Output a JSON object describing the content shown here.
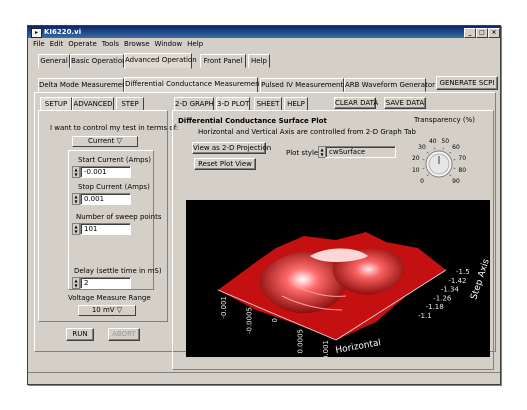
{
  "window": {
    "title": "KI6220.vi"
  },
  "menu": [
    "File",
    "Edit",
    "Operate",
    "Tools",
    "Browse",
    "Window",
    "Help"
  ],
  "tabs_top": [
    "General",
    "Basic Operation",
    "Advanced Operation",
    "Front Panel",
    "Help"
  ],
  "tabs_second": [
    "Delta Mode Measurements",
    "Differential Conductance Measurements",
    "Pulsed IV Measurements",
    "ARB Waveform Generator"
  ],
  "generate_scpi": "GENERATE SCPI",
  "left_tabs": [
    "SETUP",
    "ADVANCED",
    "STEP"
  ],
  "control": {
    "prompt": "I want to control my test in terms of:",
    "mode": "Current",
    "start_label": "Start Current (Amps)",
    "start_value": "-0.001",
    "stop_label": "Stop Current (Amps)",
    "stop_value": "0.001",
    "points_label": "Number of sweep points",
    "points_value": "101",
    "delay_label": "Delay (settle time in mS)",
    "delay_value": "2",
    "range_label": "Voltage Measure Range",
    "range_value": "10 mV"
  },
  "run_label": "RUN",
  "abort_label": "ABORT",
  "plot_tabs": [
    "2-D GRAPH",
    "3-D PLOT",
    "SHEET",
    "HELP"
  ],
  "clear_data": "CLEAR DATA",
  "save_data": "SAVE DATA",
  "plot": {
    "title": "Differential Conductance Surface Plot",
    "subtitle": "Horizontal and Vertical Axis are controlled from 2-D Graph Tab",
    "view_2d": "View as 2-D Projection",
    "reset_view": "Reset Plot View",
    "style_label": "Plot style",
    "style_value": "cwSurface",
    "transparency_label": "Transparency (%)",
    "dial_ticks": [
      "0",
      "10",
      "20",
      "30",
      "40",
      "50",
      "60",
      "70",
      "80",
      "90"
    ],
    "step_ticks": [
      "-1.5",
      "-1.42",
      "-1.34",
      "-1.26",
      "-1.18",
      "-1.1"
    ],
    "horizontal_ticks": [
      "-0.001",
      "-0.0005",
      "0",
      "0.0005",
      "0.001"
    ],
    "axis_horizontal": "Horizontal",
    "axis_step": "Step Axis",
    "surface_color": "#d81414"
  }
}
